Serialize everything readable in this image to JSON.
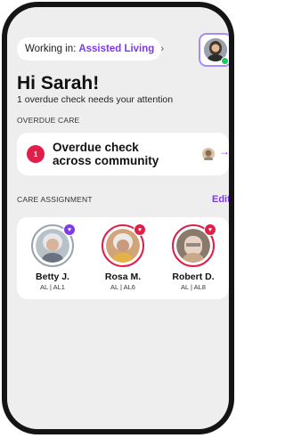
{
  "header": {
    "working_label": "Working in:",
    "working_value": "Assisted Living",
    "chevron": "›",
    "avatar_icon": "user-avatar-icon",
    "online_color": "#22c55e"
  },
  "greeting": {
    "title": "Hi Sarah!",
    "subtitle": "1 overdue check needs your attention"
  },
  "overdue": {
    "section_label": "OVERDUE CARE",
    "count": "1",
    "title": "Overdue check across community",
    "arrow": "→"
  },
  "care": {
    "section_label": "CARE ASSIGNMENT",
    "edit_label": "Edit",
    "residents": [
      {
        "name": "Betty J.",
        "unit": "AL | AL1",
        "status": "purple"
      },
      {
        "name": "Rosa M.",
        "unit": "AL | AL6",
        "status": "red"
      },
      {
        "name": "Robert D.",
        "unit": "AL | AL8",
        "status": "red"
      }
    ]
  },
  "colors": {
    "accent": "#7c3aed",
    "alert": "#e11d48"
  }
}
